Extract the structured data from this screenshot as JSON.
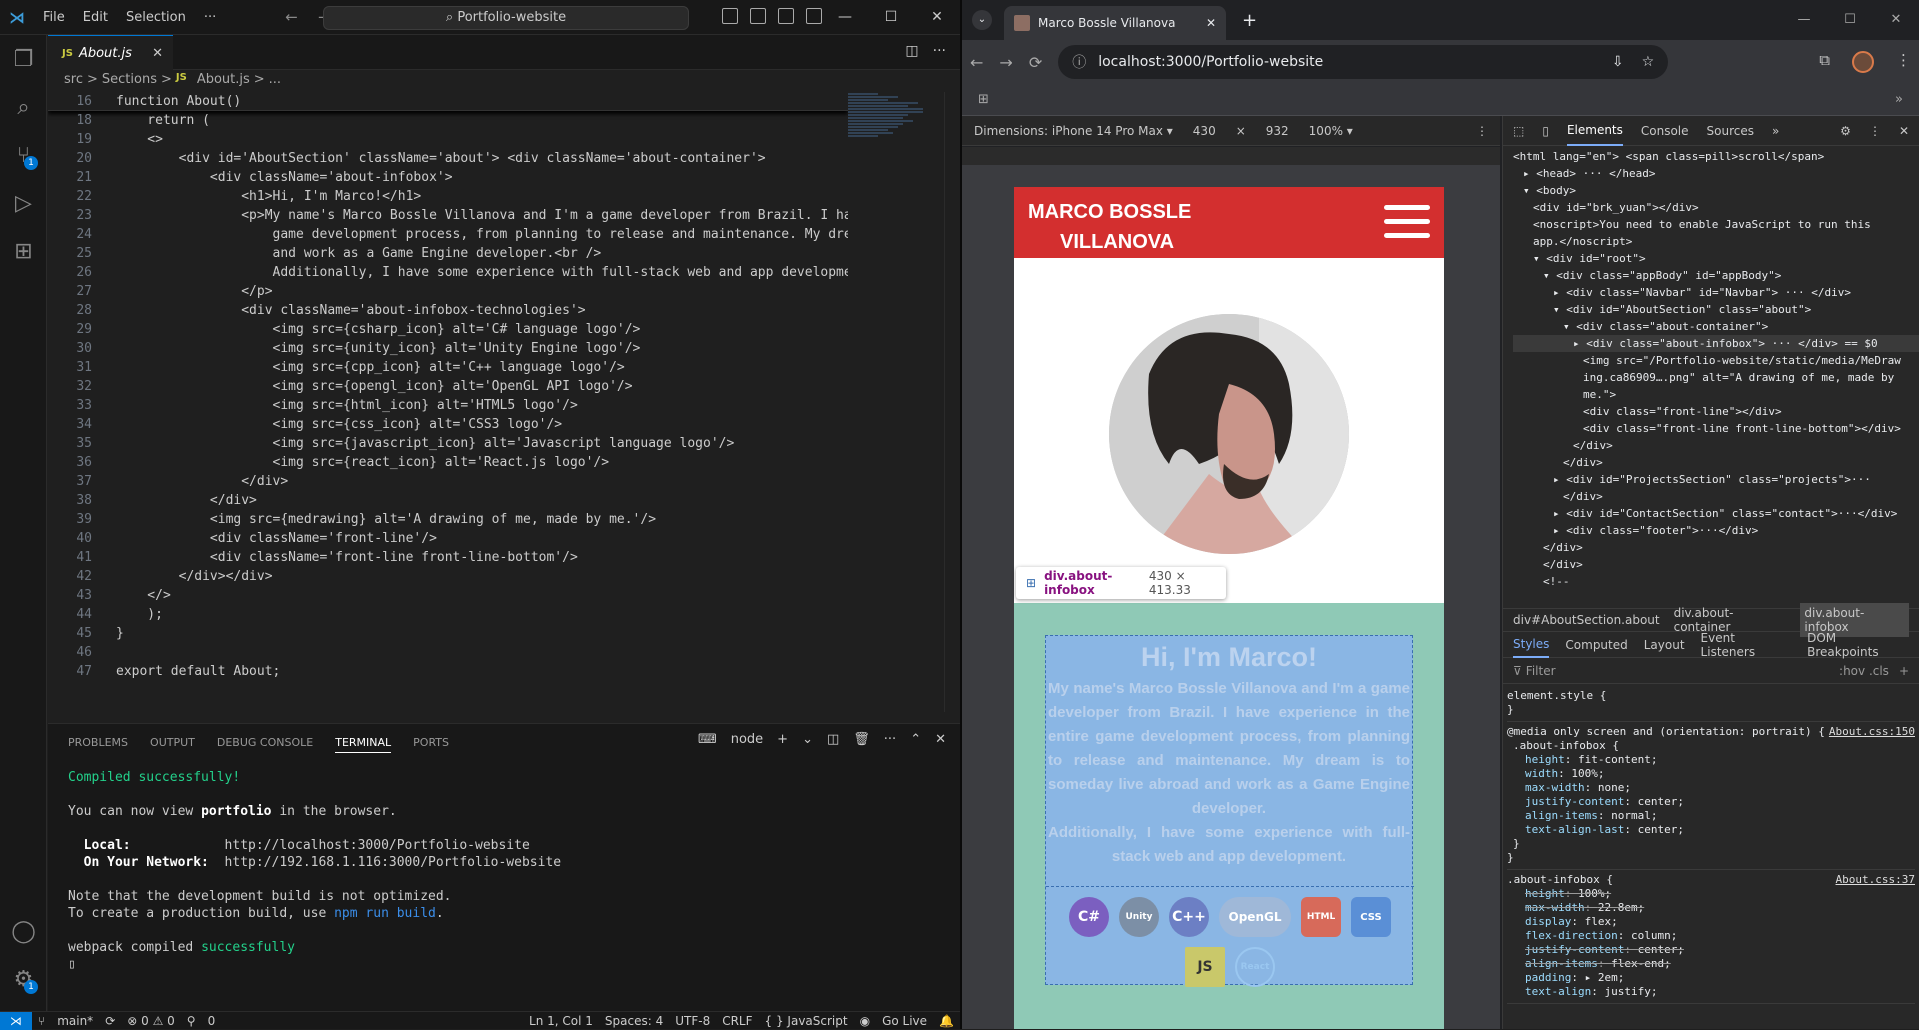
{
  "vscode": {
    "menu": [
      "File",
      "Edit",
      "Selection",
      "···"
    ],
    "command_center": "Portfolio-website",
    "tab": {
      "label": "About.js",
      "badge": "JS"
    },
    "breadcrumb": [
      "src",
      ">",
      "Sections",
      ">",
      "JS",
      "About.js",
      ">",
      "..."
    ],
    "code": [
      {
        "n": "16",
        "t": "function About()",
        "sticky": true
      },
      {
        "n": "18",
        "t": "    return ("
      },
      {
        "n": "19",
        "t": "    <>"
      },
      {
        "n": "20",
        "t": "        <div id='AboutSection' className='about'> <div className='about-container'>"
      },
      {
        "n": "21",
        "t": "            <div className='about-infobox'>"
      },
      {
        "n": "22",
        "t": "                <h1>Hi, I'm Marco!</h1>"
      },
      {
        "n": "23",
        "t": "                <p>My name's Marco Bossle Villanova and I'm a game developer from Brazil. I hav"
      },
      {
        "n": "24",
        "t": "                    game development process, from planning to release and maintenance. My drea"
      },
      {
        "n": "25",
        "t": "                    and work as a Game Engine developer.<br />"
      },
      {
        "n": "26",
        "t": "                    Additionally, I have some experience with full-stack web and app developmen"
      },
      {
        "n": "27",
        "t": "                </p>"
      },
      {
        "n": "28",
        "t": "                <div className='about-infobox-technologies'>"
      },
      {
        "n": "29",
        "t": "                    <img src={csharp_icon} alt='C# language logo'/>"
      },
      {
        "n": "30",
        "t": "                    <img src={unity_icon} alt='Unity Engine logo'/>"
      },
      {
        "n": "31",
        "t": "                    <img src={cpp_icon} alt='C++ language logo'/>"
      },
      {
        "n": "32",
        "t": "                    <img src={opengl_icon} alt='OpenGL API logo'/>"
      },
      {
        "n": "33",
        "t": "                    <img src={html_icon} alt='HTML5 logo'/>"
      },
      {
        "n": "34",
        "t": "                    <img src={css_icon} alt='CSS3 logo'/>"
      },
      {
        "n": "35",
        "t": "                    <img src={javascript_icon} alt='Javascript language logo'/>"
      },
      {
        "n": "36",
        "t": "                    <img src={react_icon} alt='React.js logo'/>"
      },
      {
        "n": "37",
        "t": "                </div>"
      },
      {
        "n": "38",
        "t": "            </div>"
      },
      {
        "n": "39",
        "t": "            <img src={medrawing} alt='A drawing of me, made by me.'/>"
      },
      {
        "n": "40",
        "t": "            <div className='front-line'/>"
      },
      {
        "n": "41",
        "t": "            <div className='front-line front-line-bottom'/>"
      },
      {
        "n": "42",
        "t": "        </div></div>"
      },
      {
        "n": "43",
        "t": "    </>"
      },
      {
        "n": "44",
        "t": "    );"
      },
      {
        "n": "45",
        "t": "}"
      },
      {
        "n": "46",
        "t": ""
      },
      {
        "n": "47",
        "t": "export default About;"
      }
    ],
    "panel_tabs": [
      "PROBLEMS",
      "OUTPUT",
      "DEBUG CONSOLE",
      "TERMINAL",
      "PORTS"
    ],
    "terminal_shell": "node",
    "terminal": {
      "compiled": "Compiled successfully!",
      "view_a": "You can now view ",
      "view_b": "portfolio",
      "view_c": " in the browser.",
      "local_label": "Local:",
      "local_url": "http://localhost:3000/Portfolio-website",
      "network_label": "On Your Network:",
      "network_url": "http://192.168.1.116:3000/Portfolio-website",
      "note1": "Note that the development build is not optimized.",
      "note2a": "To create a production build, use ",
      "note2b": "npm run build",
      "note2c": ".",
      "webpack_a": "webpack compiled ",
      "webpack_b": "successfully"
    },
    "status": {
      "branch": "main*",
      "errors": "⊗ 0 ⚠ 0",
      "ports": "0",
      "position": "Ln 1, Col 1",
      "spaces": "Spaces: 4",
      "encoding": "UTF-8",
      "eol": "CRLF",
      "language": "{ } JavaScript",
      "golive": "Go Live"
    }
  },
  "chrome": {
    "tab_title": "Marco Bossle Villanova",
    "url": "localhost:3000/Portfolio-website",
    "device": {
      "dimensions": "Dimensions: iPhone 14 Pro Max ▾",
      "width": "430",
      "x": "×",
      "height": "932",
      "zoom": "100% ▾"
    },
    "site": {
      "nav_line1": "MARCO BOSSLE",
      "nav_line2": "VILLANOVA",
      "heading": "Hi, I'm Marco!",
      "paragraph": "My name's Marco Bossle Villanova and I'm a game developer from Brazil. I have experience in the entire game development process, from planning to release and maintenance. My dream is to someday live abroad and work as a Game Engine developer.",
      "paragraph2": "Additionally, I have some experience with full-stack web and app development.",
      "tech": [
        "C#",
        "Unity",
        "C++",
        "OpenGL",
        "HTML",
        "CSS",
        "JS",
        "React"
      ]
    },
    "tooltip": {
      "name": "div.about-infobox",
      "size": "430 × 413.33"
    }
  },
  "devtools": {
    "tabs": [
      "Elements",
      "Console",
      "Sources"
    ],
    "dom": [
      {
        "i": 0,
        "h": "<html lang=\"en\"> <span class=pill>scroll</span>"
      },
      {
        "i": 1,
        "h": "▸ <head> ··· </head>"
      },
      {
        "i": 1,
        "h": "▾ <body>"
      },
      {
        "i": 2,
        "h": "<div id=\"brk_yuan\"></div>"
      },
      {
        "i": 2,
        "h": "<noscript>You need to enable JavaScript to run this"
      },
      {
        "i": 2,
        "h": "app.</noscript>"
      },
      {
        "i": 2,
        "h": "▾ <div id=\"root\">"
      },
      {
        "i": 3,
        "h": "▾ <div class=\"appBody\" id=\"appBody\">"
      },
      {
        "i": 4,
        "h": "▸ <div class=\"Navbar\" id=\"Navbar\"> ··· </div>"
      },
      {
        "i": 4,
        "h": "▾ <div id=\"AboutSection\" class=\"about\">"
      },
      {
        "i": 5,
        "h": "▾ <div class=\"about-container\">"
      },
      {
        "i": 6,
        "h": "▸ <div class=\"about-infobox\"> ··· </div> == $0",
        "sel": true
      },
      {
        "i": 7,
        "h": "<img src=\"/Portfolio-website/static/media/MeDraw"
      },
      {
        "i": 7,
        "h": "ing.ca86909….png\" alt=\"A drawing of me, made by"
      },
      {
        "i": 7,
        "h": "me.\">"
      },
      {
        "i": 7,
        "h": "<div class=\"front-line\"></div>"
      },
      {
        "i": 7,
        "h": "<div class=\"front-line front-line-bottom\"></div>"
      },
      {
        "i": 6,
        "h": "</div>"
      },
      {
        "i": 5,
        "h": "</div>"
      },
      {
        "i": 4,
        "h": "▸ <div id=\"ProjectsSection\" class=\"projects\">···"
      },
      {
        "i": 5,
        "h": "</div>"
      },
      {
        "i": 4,
        "h": "▸ <div id=\"ContactSection\" class=\"contact\">···</div>"
      },
      {
        "i": 4,
        "h": "▸ <div class=\"footer\">···</div>"
      },
      {
        "i": 3,
        "h": "</div>"
      },
      {
        "i": 3,
        "h": "</div>"
      },
      {
        "i": 3,
        "h": "<!--"
      }
    ],
    "crumbs": [
      "div#AboutSection.about",
      "div.about-container",
      "div.about-infobox"
    ],
    "style_tabs": [
      "Styles",
      "Computed",
      "Layout",
      "Event Listeners",
      "DOM Breakpoints"
    ],
    "filter": "Filter",
    "filter_right": ":hov .cls",
    "element_style": "element.style {",
    "media": "@media only screen and (orientation: portrait) {",
    "src1": "About.css:150",
    "src2": "About.css:37",
    "rule1_sel": ".about-infobox {",
    "rule1": [
      {
        "p": "height",
        "v": "fit-content;"
      },
      {
        "p": "width",
        "v": "100%;"
      },
      {
        "p": "max-width",
        "v": "none;"
      },
      {
        "p": "justify-content",
        "v": "center;"
      },
      {
        "p": "align-items",
        "v": "normal;"
      },
      {
        "p": "text-align-last",
        "v": "center;"
      }
    ],
    "rule2_sel": ".about-infobox {",
    "rule2": [
      {
        "p": "height",
        "v": "100%;",
        "s": true
      },
      {
        "p": "max-width",
        "v": "22.8em;",
        "s": true
      },
      {
        "p": "display",
        "v": "flex;"
      },
      {
        "p": "flex-direction",
        "v": "column;"
      },
      {
        "p": "justify-content",
        "v": "center;",
        "s": true
      },
      {
        "p": "align-items",
        "v": "flex-end;",
        "s": true
      },
      {
        "p": "padding",
        "v": "▸ 2em;"
      },
      {
        "p": "text-align",
        "v": "justify;"
      }
    ]
  }
}
